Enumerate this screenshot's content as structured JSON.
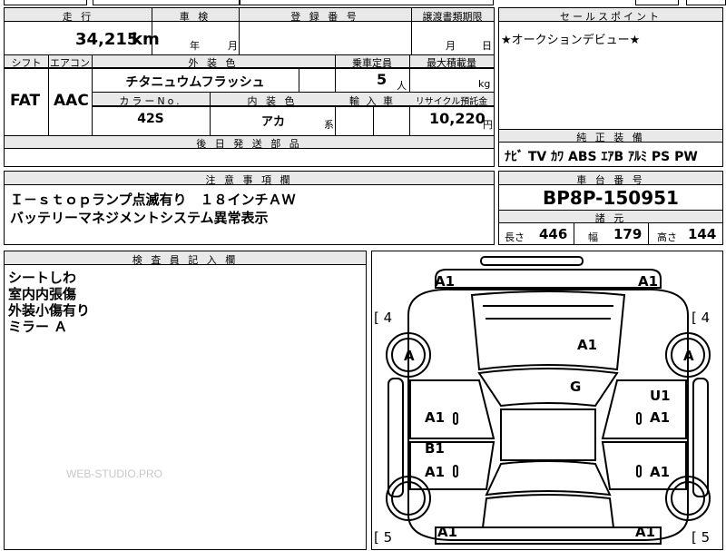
{
  "headers": {
    "mileage": "走 行",
    "inspection": "車 検",
    "registration": "登 録 番 号",
    "transfer_deadline": "譲渡書類期限",
    "sales_point": "セールスポイント",
    "shift": "シフト",
    "aircon": "エアコン",
    "exterior_color": "外 装 色",
    "capacity": "乗車定員",
    "max_load": "最大積載量",
    "color_no": "カラーNo.",
    "interior_color": "内 装 色",
    "import": "輸 入 車",
    "recycle": "リサイクル預託金",
    "later_parts": "後 日 発 送 部 品",
    "factory_equipment": "純 正 装 備",
    "notes": "注 意 事 項 欄",
    "chassis": "車 台 番 号",
    "dimensions": "諸 元",
    "inspector": "検 査 員 記 入 欄"
  },
  "values": {
    "mileage": "34,215",
    "mileage_unit": "km",
    "inspection_year_unit": "年",
    "inspection_month_unit": "月",
    "transfer_month_unit": "月",
    "transfer_day_unit": "日",
    "sales_point_text": "★オークションデビュー★",
    "shift": "FAT",
    "aircon": "AAC",
    "exterior_color": "チタニュウムフラッシュ",
    "capacity": "5",
    "capacity_unit": "人",
    "load_unit": "kg",
    "color_no": "42S",
    "interior_color": "アカ",
    "interior_suffix": "系",
    "recycle_fee": "10,220",
    "recycle_unit": "円",
    "equipment": "ﾅﾋﾞ  TV  ｶﾜ  ABS  ｴｱB  ｱﾙﾐ  PS  PW",
    "notes_line1": "Ｉ－ｓｔｏｐランプ点滅有り　１８インチＡＷ",
    "notes_line2": "バッテリーマネジメントシステム異常表示",
    "chassis_no": "BP8P-150951",
    "length_label": "長さ",
    "length": "446",
    "width_label": "幅",
    "width": "179",
    "height_label": "高さ",
    "height": "144",
    "inspector_lines": [
      "シートしわ",
      "室内内張傷",
      "外装小傷有り",
      "ミラー Ａ"
    ],
    "watermark": "WEB-STUDIO.PRO"
  },
  "diagram_marks": {
    "a1_front_left": "A1",
    "a1_front_right": "A1",
    "bracket_left_top": "[ 4",
    "bracket_right_top": "[ 4",
    "tire_left_front": "A",
    "tire_right_front": "A",
    "a1_hood": "A1",
    "g_windshield": "G",
    "u1": "U1",
    "a1_door_left_front": "A1",
    "a1_door_right_front": "A1",
    "b1": "B1",
    "a1_door_left_rear": "A1",
    "a1_door_right_rear": "A1",
    "bracket_left_bottom": "[ 5",
    "bracket_right_bottom": "[ 5",
    "a1_rear_left": "A1",
    "a1_rear_right": "A1"
  }
}
